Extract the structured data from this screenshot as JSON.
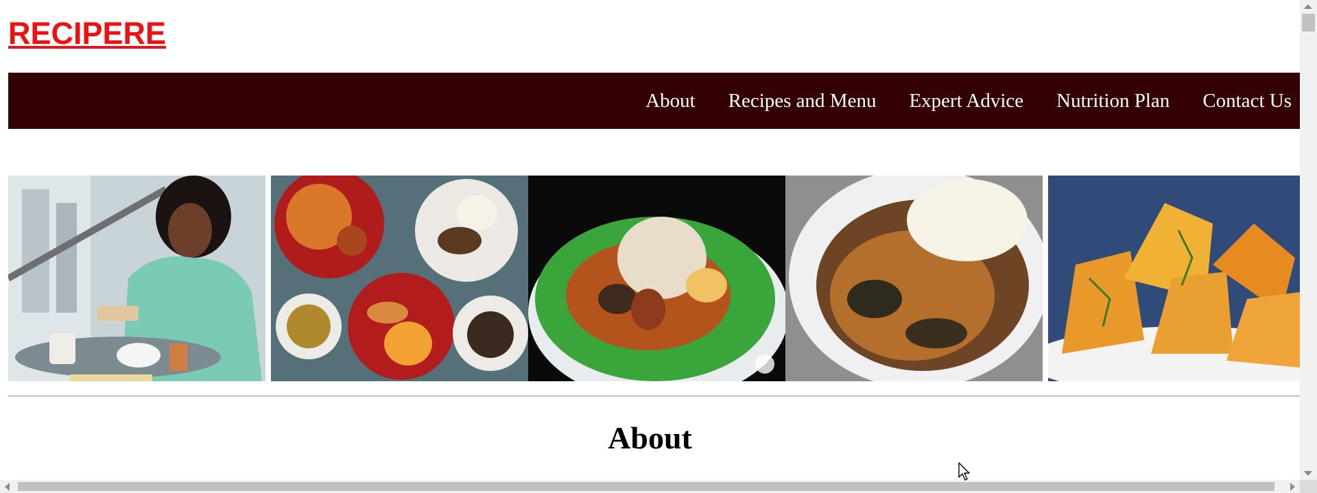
{
  "site": {
    "logo": "RECIPERE"
  },
  "nav": {
    "items": [
      {
        "label": "About"
      },
      {
        "label": "Recipes and Menu"
      },
      {
        "label": "Expert Advice"
      },
      {
        "label": "Nutrition Plan"
      },
      {
        "label": "Contact Us"
      }
    ]
  },
  "gallery": {
    "images": [
      {
        "icon": "photo-woman-breakfast"
      },
      {
        "icon": "photo-jollof-rice-platter"
      },
      {
        "icon": "photo-ofada-rice-leaf"
      },
      {
        "icon": "photo-egusi-soup-fufu"
      },
      {
        "icon": "photo-moi-moi"
      }
    ]
  },
  "section": {
    "title": "About"
  },
  "colors": {
    "brand": "#ee1111",
    "navbar": "#330003",
    "nav_text": "#ffffff"
  }
}
